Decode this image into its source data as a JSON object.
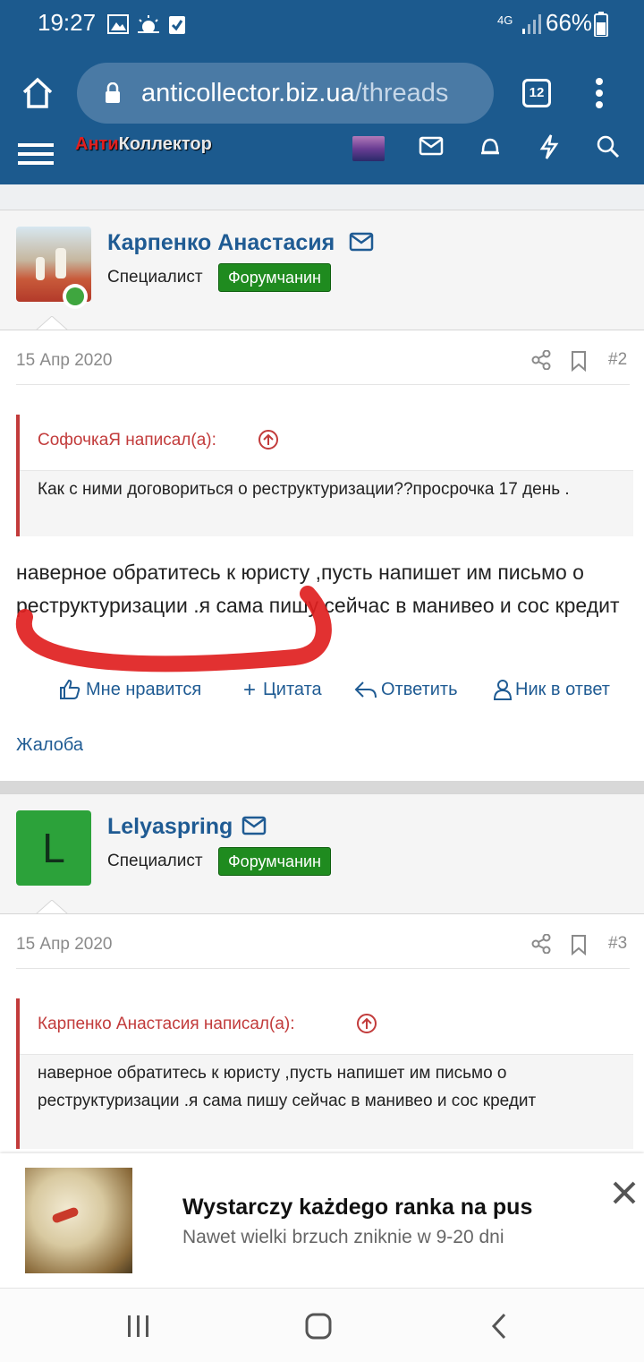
{
  "status_bar": {
    "time": "19:27",
    "network": "4G",
    "battery": "66%"
  },
  "browser": {
    "url_domain": "anticollector.biz.ua",
    "url_path": "/threads",
    "tab_count": "12"
  },
  "site": {
    "logo_red": "Анти",
    "logo_white": "Коллектор"
  },
  "posts": [
    {
      "author": "Карпенко Анастасия",
      "title": "Специалист",
      "badge": "Форумчанин",
      "date": "15 Апр 2020",
      "number": "#2",
      "quote_author": "СофочкаЯ написал(а):",
      "quote_text": "Как с ними договориться о реструктуризации??просрочка 17 день .",
      "message": "наверное обратитесь к юристу ,пусть напишет им письмо о реструктуризации .я сама пишу сейчас в манивео и сос кредит",
      "actions": {
        "like": "Мне нравится",
        "quote": "Цитата",
        "reply": "Ответить",
        "mention": "Ник в ответ",
        "report": "Жалоба"
      }
    },
    {
      "author": "Lelyaspring",
      "avatar_letter": "L",
      "title": "Специалист",
      "badge": "Форумчанин",
      "date": "15 Апр 2020",
      "number": "#3",
      "quote_author": "Карпенко Анастасия написал(а):",
      "quote_text": "наверное обратитесь к юристу ,пусть напишет им письмо о реструктуризации .я сама пишу сейчас в манивео и сос кредит"
    }
  ],
  "ad": {
    "title": "Wystarczy każdego ranka na pus",
    "subtitle": "Nawet wielki brzuch zniknie w 9-20 dni"
  },
  "colors": {
    "header": "#1c5a8e",
    "link": "#1f5b93",
    "badge": "#1f8b1f",
    "quote_accent": "#c23b3b",
    "annotation": "#e02020"
  }
}
